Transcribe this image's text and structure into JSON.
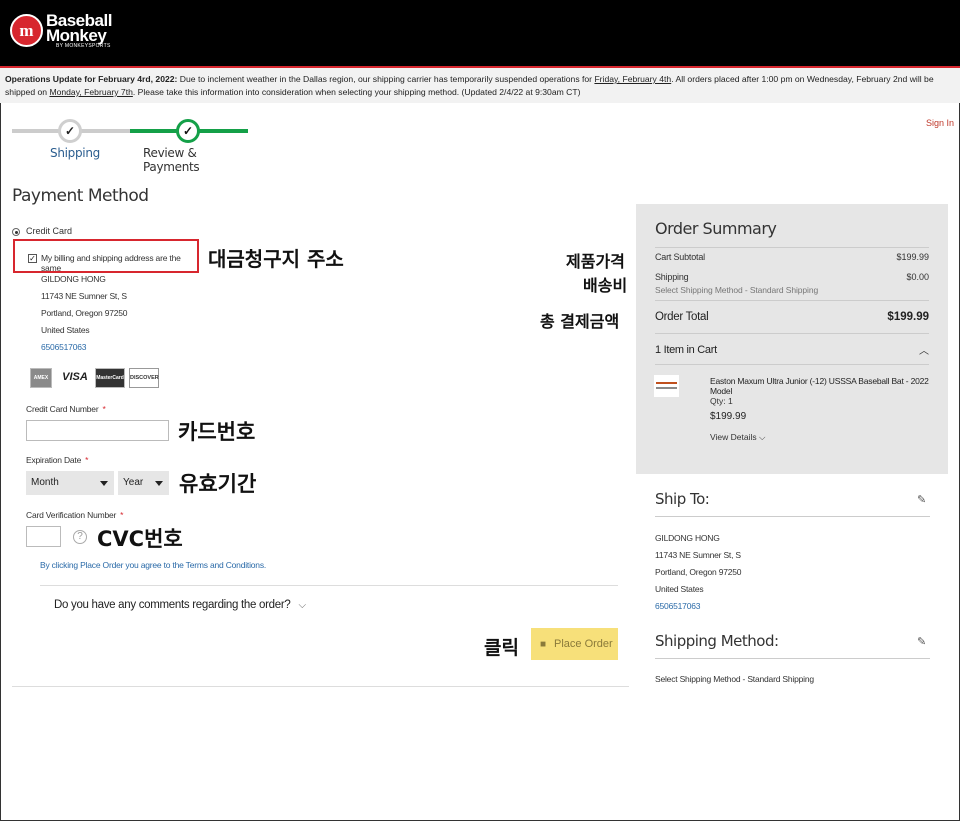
{
  "header": {
    "logo_line1": "Baseball",
    "logo_line2": "Monkey",
    "logo_tagline": "BY MONKEYSPORTS",
    "logo_badge": "m"
  },
  "ops": {
    "label": "Operations Update for February 4rd, 2022:",
    "text1": " Due to inclement weather in the Dallas region, our shipping carrier has temporarily suspended operations for ",
    "date1": "Friday, February 4th",
    "text2": ". All orders placed after 1:00 pm on Wednesday, February 2nd will be shipped on ",
    "date2": "Monday, February 7th",
    "text3": ". Please take this information into consideration when selecting your shipping method. (Updated 2/4/22 at 9:30am CT)"
  },
  "progress": {
    "steps": [
      {
        "label": "Shipping",
        "icon": "check-icon"
      },
      {
        "label": "Review & Payments",
        "icon": "check-icon"
      }
    ],
    "check_glyph": "✓"
  },
  "signin": "Sign In",
  "payment": {
    "title": "Payment Method",
    "method_label": "Credit Card",
    "billing_same_label": "My billing and shipping address are the same",
    "billing_checked": true,
    "address": {
      "name": "GILDONG HONG",
      "street": "11743 NE Sumner St, S",
      "city": "Portland, Oregon 97250",
      "country": "United States",
      "phone": "6506517063"
    },
    "card_logos": [
      "AMEX",
      "VISA",
      "MasterCard",
      "DISCOVER"
    ],
    "card_number_label": "Credit Card Number",
    "expiration_label": "Expiration Date",
    "month_placeholder": "Month",
    "year_placeholder": "Year",
    "cvv_label": "Card Verification Number",
    "required_mark": "*",
    "help_glyph": "?",
    "terms": "By clicking Place Order you agree to the Terms and Conditions.",
    "comments_label": "Do you have any comments regarding the order?",
    "comments_chevron": "⌵",
    "place_order_label": "Place Order",
    "lock_glyph": "🔒"
  },
  "annotations": {
    "billing": "대금청구지 주소",
    "price": "제품가격",
    "shipping": "배송비",
    "total": "총 결제금액",
    "card": "카드번호",
    "expiry": "유효기간",
    "cvc": "CVC번호",
    "click": "클릭"
  },
  "summary": {
    "title": "Order Summary",
    "cart_subtotal_label": "Cart Subtotal",
    "cart_subtotal_value": "$199.99",
    "shipping_label": "Shipping",
    "shipping_value": "$0.00",
    "shipping_method": "Select Shipping Method - Standard Shipping",
    "order_total_label": "Order Total",
    "order_total_value": "$199.99",
    "items_label": "1 Item in Cart",
    "collapse_glyph": "︿",
    "product": {
      "name": "Easton Maxum Ultra Junior (-12) USSSA Baseball Bat - 2022 Model",
      "qty": "Qty: 1",
      "price": "$199.99",
      "view_details": "View Details ⌵"
    }
  },
  "ship_to": {
    "title": "Ship To:",
    "name": "GILDONG HONG",
    "street": "11743 NE Sumner St, S",
    "city": "Portland, Oregon 97250",
    "country": "United States",
    "phone": "6506517063",
    "edit_glyph": "✎"
  },
  "shipping_method": {
    "title": "Shipping Method:",
    "value": "Select Shipping Method - Standard Shipping",
    "edit_glyph": "✎"
  }
}
